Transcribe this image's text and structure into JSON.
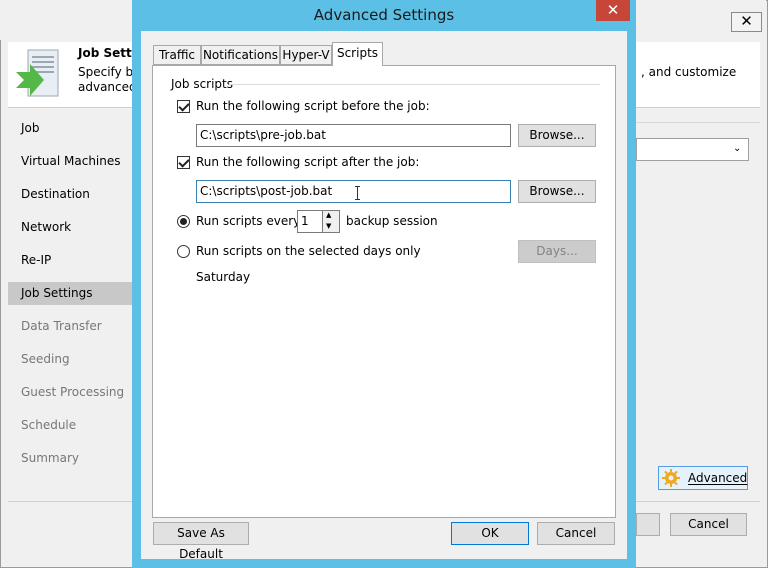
{
  "background_window": {
    "close_glyph": "✕",
    "header": {
      "title": "Job Settin",
      "desc_line1": "Specify ba",
      "desc_line2": "advanced ,",
      "desc_right": ", and customize"
    },
    "steps": [
      {
        "label": "Job",
        "state": "enabled"
      },
      {
        "label": "Virtual Machines",
        "state": "enabled"
      },
      {
        "label": "Destination",
        "state": "enabled"
      },
      {
        "label": "Network",
        "state": "enabled"
      },
      {
        "label": "Re-IP",
        "state": "enabled"
      },
      {
        "label": "Job Settings",
        "state": "active"
      },
      {
        "label": "Data Transfer",
        "state": "disabled"
      },
      {
        "label": "Seeding",
        "state": "disabled"
      },
      {
        "label": "Guest Processing",
        "state": "disabled"
      },
      {
        "label": "Schedule",
        "state": "disabled"
      },
      {
        "label": "Summary",
        "state": "disabled"
      }
    ],
    "dropdown_arrow": "⌄",
    "advanced_label": "Advanced",
    "cancel_label": "Cancel"
  },
  "dialog": {
    "title": "Advanced Settings",
    "close_glyph": "✕",
    "tabs": [
      "Traffic",
      "Notifications",
      "Hyper-V",
      "Scripts"
    ],
    "active_tab": "Scripts",
    "group_label": "Job scripts",
    "before_job": {
      "label": "Run the following script before the job:",
      "checked": true,
      "value": "C:\\scripts\\pre-job.bat",
      "browse_label": "Browse..."
    },
    "after_job": {
      "label": "Run the following script after the job:",
      "checked": true,
      "value": "C:\\scripts\\post-job.bat",
      "browse_label": "Browse..."
    },
    "run_every": {
      "label": "Run scripts every",
      "value": "1",
      "suffix": "backup session",
      "selected": true
    },
    "run_days": {
      "label": "Run scripts on the selected days only",
      "selected": false,
      "days_label": "Days...",
      "days_value": "Saturday"
    },
    "save_default_label": "Save As Default",
    "ok_label": "OK",
    "cancel_label": "Cancel"
  },
  "colors": {
    "dialog_frame": "#5cc0e6",
    "close_button": "#c7463a",
    "active_step": "#c8c8c8",
    "focus_border": "#3c7fb1",
    "advanced_button_bg": "#e5f1fb"
  }
}
